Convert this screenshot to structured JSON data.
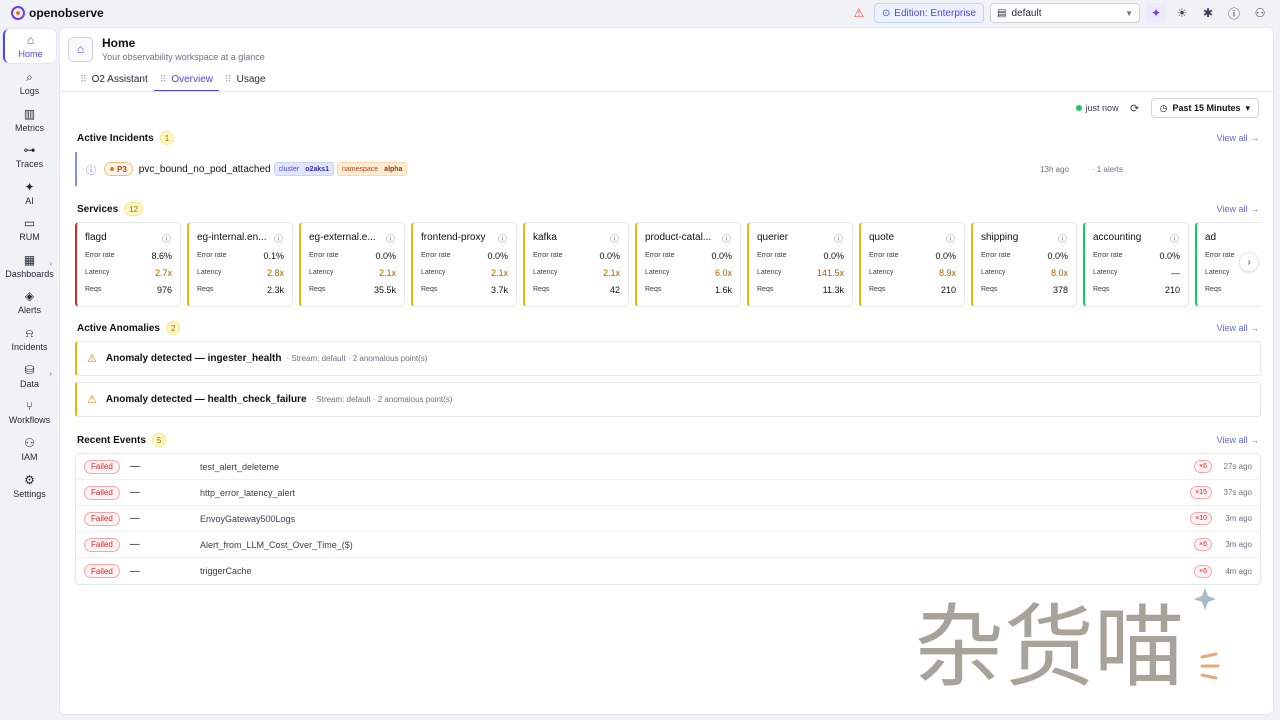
{
  "app": {
    "brand": "openobserve"
  },
  "topbar": {
    "edition": "Edition: Enterprise",
    "org": "default"
  },
  "sidebar": {
    "items": [
      {
        "label": "Home",
        "icon": "⌂",
        "name": "home"
      },
      {
        "label": "Logs",
        "icon": "⌕",
        "name": "logs"
      },
      {
        "label": "Metrics",
        "icon": "▥",
        "name": "metrics"
      },
      {
        "label": "Traces",
        "icon": "⊶",
        "name": "traces"
      },
      {
        "label": "AI",
        "icon": "✦",
        "name": "ai"
      },
      {
        "label": "RUM",
        "icon": "▭",
        "name": "rum"
      },
      {
        "label": "Dashboards",
        "icon": "▦",
        "name": "dashboards"
      },
      {
        "label": "Alerts",
        "icon": "◈",
        "name": "alerts"
      },
      {
        "label": "Incidents",
        "icon": "⍾",
        "name": "incidents"
      },
      {
        "label": "Data",
        "icon": "⛁",
        "name": "data"
      },
      {
        "label": "Workflows",
        "icon": "⑂",
        "name": "workflows"
      },
      {
        "label": "IAM",
        "icon": "⚇",
        "name": "iam"
      },
      {
        "label": "Settings",
        "icon": "⚙",
        "name": "settings"
      }
    ]
  },
  "header": {
    "title": "Home",
    "subtitle": "Your observability workspace at a glance"
  },
  "tabs": [
    {
      "label": "O2 Assistant"
    },
    {
      "label": "Overview"
    },
    {
      "label": "Usage"
    }
  ],
  "refresh": {
    "status": "just now",
    "range": "Past 15 Minutes"
  },
  "incidents": {
    "title": "Active Incidents",
    "count": "1",
    "view_all": "View all →",
    "items": [
      {
        "priority": "P3",
        "name": "pvc_bound_no_pod_attached",
        "cluster_key": "cluster",
        "cluster_val": "o2aks1",
        "ns_key": "namespace",
        "ns_val": "alpha",
        "time": "13h ago",
        "alerts": "· 1 alerts"
      }
    ]
  },
  "services": {
    "title": "Services",
    "count": "12",
    "view_all": "View all →",
    "row_labels": {
      "error": "Error rate",
      "latency": "Latency",
      "reqs": "Reqs"
    },
    "items": [
      {
        "name": "flagd",
        "error": "8.6%",
        "latency": "2.7x",
        "reqs": "976",
        "color": "#dc2626",
        "lat_warn": true
      },
      {
        "name": "eg-internal.en...",
        "error": "0.1%",
        "latency": "2.8x",
        "reqs": "2.3k",
        "color": "#eab308",
        "lat_warn": true
      },
      {
        "name": "eg-external.e...",
        "error": "0.0%",
        "latency": "2.1x",
        "reqs": "35.5k",
        "color": "#eab308",
        "lat_warn": true
      },
      {
        "name": "frontend-proxy",
        "error": "0.0%",
        "latency": "2.1x",
        "reqs": "3.7k",
        "color": "#eab308",
        "lat_warn": true
      },
      {
        "name": "kafka",
        "error": "0.0%",
        "latency": "2.1x",
        "reqs": "42",
        "color": "#eab308",
        "lat_warn": true
      },
      {
        "name": "product-catal...",
        "error": "0.0%",
        "latency": "6.0x",
        "reqs": "1.6k",
        "color": "#eab308",
        "lat_warn": true
      },
      {
        "name": "querier",
        "error": "0.0%",
        "latency": "141.5x",
        "reqs": "11.3k",
        "color": "#eab308",
        "lat_warn": true
      },
      {
        "name": "quote",
        "error": "0.0%",
        "latency": "8.9x",
        "reqs": "210",
        "color": "#eab308",
        "lat_warn": true
      },
      {
        "name": "shipping",
        "error": "0.0%",
        "latency": "8.0x",
        "reqs": "378",
        "color": "#eab308",
        "lat_warn": true
      },
      {
        "name": "accounting",
        "error": "0.0%",
        "latency": "—",
        "reqs": "210",
        "color": "#22c55e",
        "lat_warn": false
      },
      {
        "name": "ad",
        "error": "",
        "latency": "",
        "reqs": "",
        "color": "#22c55e",
        "lat_warn": false
      }
    ]
  },
  "anomalies": {
    "title": "Active Anomalies",
    "count": "2",
    "view_all": "View all →",
    "items": [
      {
        "title": "Anomaly detected — ingester_health",
        "meta": "· Stream: default · 2 anomalous point(s)"
      },
      {
        "title": "Anomaly detected — health_check_failure",
        "meta": "· Stream: default · 2 anomalous point(s)"
      }
    ]
  },
  "events": {
    "title": "Recent Events",
    "count": "5",
    "view_all": "View all →",
    "items": [
      {
        "status": "Failed",
        "dash": "—",
        "name": "test_alert_deleteme",
        "count": "×6",
        "time": "27s ago"
      },
      {
        "status": "Failed",
        "dash": "—",
        "name": "http_error_latency_alert",
        "count": "×15",
        "time": "37s ago"
      },
      {
        "status": "Failed",
        "dash": "—",
        "name": "EnvoyGateway500Logs",
        "count": "×10",
        "time": "3m ago"
      },
      {
        "status": "Failed",
        "dash": "—",
        "name": "Alert_from_LLM_Cost_Over_Time_($)",
        "count": "×6",
        "time": "3m ago"
      },
      {
        "status": "Failed",
        "dash": "—",
        "name": "triggerCache",
        "count": "×6",
        "time": "4m ago"
      }
    ]
  },
  "watermark": {
    "text": "杂货喵"
  }
}
